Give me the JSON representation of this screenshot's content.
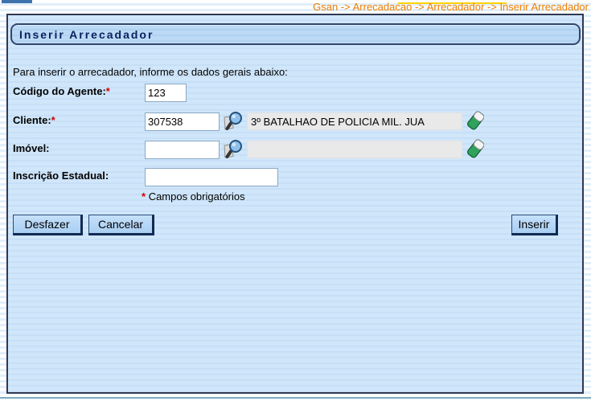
{
  "header": {
    "breadcrumb": "Gsan -> Arrecadacao -> Arrecadador -> Inserir Arrecadador"
  },
  "page": {
    "title": "Inserir Arrecadador",
    "instruction": "Para inserir o arrecadador, informe os dados gerais abaixo:",
    "required_marker": "*",
    "required_note": "Campos obrigatórios"
  },
  "form": {
    "codigo_agente": {
      "label": "Código do Agente:",
      "value": "123"
    },
    "cliente": {
      "label": "Cliente:",
      "value": "307538",
      "display": "3º BATALHAO DE POLICIA MIL. JUA"
    },
    "imovel": {
      "label": "Imóvel:",
      "value": "",
      "display": ""
    },
    "inscricao_estadual": {
      "label": "Inscrição Estadual:",
      "value": ""
    }
  },
  "buttons": {
    "desfazer": "Desfazer",
    "cancelar": "Cancelar",
    "inserir": "Inserir"
  },
  "icons": {
    "search": "search-icon",
    "erase": "eraser-icon"
  },
  "colors": {
    "breadcrumb_orange": "#ee7e00",
    "panel_blue": "#cde4f8",
    "panel_border": "#303850",
    "button_blue": "#b2d4f5",
    "eraser_green": "#2fa25c",
    "footer_teal": "#84adbc",
    "highlight_yellow": "#ffd200"
  }
}
